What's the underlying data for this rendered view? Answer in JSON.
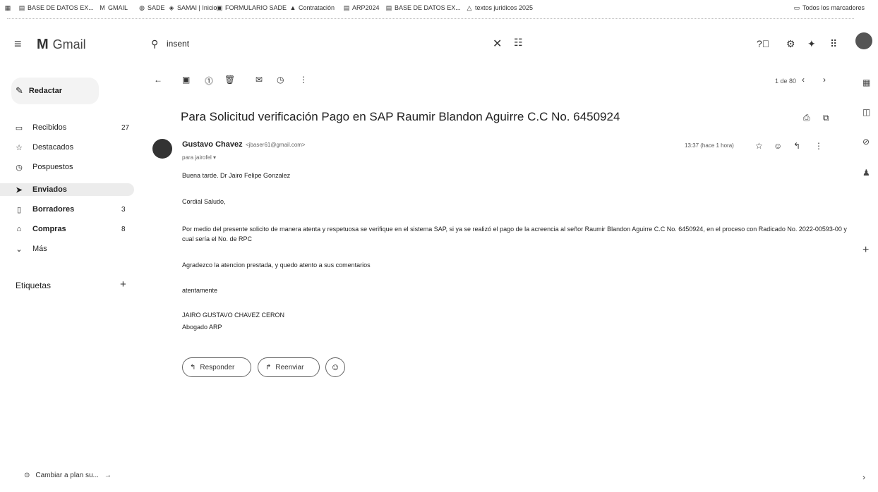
{
  "bookmarks": {
    "items": [
      {
        "label": "BASE DE DATOS EX...",
        "icon": "sheets-icon"
      },
      {
        "label": "GMAIL",
        "icon": "gmail-icon"
      },
      {
        "label": "SADE",
        "icon": "globe-icon"
      },
      {
        "label": "SAMAI | Inicio",
        "icon": "globe-icon"
      },
      {
        "label": "FORMULARIO SADE",
        "icon": "form-icon"
      },
      {
        "label": "Contratación",
        "icon": "triangle-icon"
      },
      {
        "label": "ARP2024",
        "icon": "sheets-icon"
      },
      {
        "label": "BASE DE DATOS EX...",
        "icon": "sheets-icon"
      },
      {
        "label": "textos juridicos 2025",
        "icon": "drive-icon"
      }
    ],
    "all_bookmarks": "Todos los marcadores"
  },
  "header": {
    "app_name": "Gmail",
    "search_value": "insent"
  },
  "sidebar": {
    "compose_label": "Redactar",
    "items": [
      {
        "label": "Recibidos",
        "count": "27",
        "icon": "inbox-icon"
      },
      {
        "label": "Destacados",
        "count": "",
        "icon": "star-icon"
      },
      {
        "label": "Pospuestos",
        "count": "",
        "icon": "clock-icon"
      },
      {
        "label": "Enviados",
        "count": "",
        "icon": "send-icon"
      },
      {
        "label": "Borradores",
        "count": "3",
        "icon": "draft-icon"
      },
      {
        "label": "Compras",
        "count": "8",
        "icon": "bag-icon"
      },
      {
        "label": "Más",
        "count": "",
        "icon": "chevron-down-icon"
      }
    ],
    "labels_title": "Etiquetas",
    "upgrade_label": "Cambiar a plan su..."
  },
  "toolbar": {
    "pager": "1 de 80"
  },
  "email": {
    "subject": "Para Solicitud verificación Pago en SAP Raumir Blandon Aguirre C.C No. 6450924",
    "sender_name": "Gustavo Chavez",
    "sender_email": "<jbaser61@gmail.com>",
    "to_line": "para jairofel ▾",
    "timestamp": "13:37 (hace 1 hora)",
    "greeting": "Buena tarde. Dr Jairo Felipe Gonzalez",
    "salutation": "Cordial Saludo,",
    "paragraph_1": "Por medio del presente solicito de manera atenta y respetuosa se verifique en el sistema SAP, si ya se realizó el pago de la acreencia al señor Raumir Blandon Aguirre C.C No. 6450924, en el proceso con Radicado No. 2022-00593-00 y cual sería el No. de RPC",
    "paragraph_2": "Agradezco la atencion prestada, y quedo atento a sus comentarios",
    "closing": "atentamente",
    "signature_name": "JAIRO GUSTAVO CHAVEZ CERON",
    "signature_title": "Abogado ARP",
    "reply_label": "Responder",
    "forward_label": "Reenviar"
  }
}
